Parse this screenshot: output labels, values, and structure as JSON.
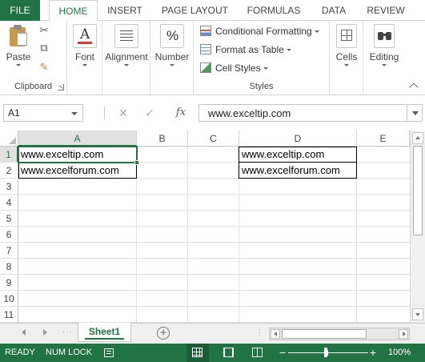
{
  "tabs": {
    "file": "FILE",
    "home": "HOME",
    "insert": "INSERT",
    "page_layout": "PAGE LAYOUT",
    "formulas": "FORMULAS",
    "data": "DATA",
    "review": "REVIEW"
  },
  "ribbon": {
    "clipboard": {
      "paste": "Paste",
      "group_label": "Clipboard"
    },
    "font": {
      "label": "Font"
    },
    "alignment": {
      "label": "Alignment"
    },
    "number": {
      "label": "Number"
    },
    "styles": {
      "conditional_formatting": "Conditional Formatting",
      "format_as_table": "Format as Table",
      "cell_styles": "Cell Styles",
      "group_label": "Styles"
    },
    "cells": {
      "label": "Cells"
    },
    "editing": {
      "label": "Editing"
    }
  },
  "formula_bar": {
    "name_box": "A1",
    "cancel_glyph": "✕",
    "enter_glyph": "✓",
    "fx_glyph": "fx",
    "content": "www.exceltip.com"
  },
  "grid": {
    "columns": [
      "A",
      "B",
      "C",
      "D",
      "E"
    ],
    "rows": [
      "1",
      "2",
      "3",
      "4",
      "5",
      "6",
      "7",
      "8",
      "9",
      "10",
      "11"
    ],
    "cells": {
      "A1": "www.exceltip.com",
      "A2": "www.excelforum.com",
      "D1": "www.exceltip.com",
      "D2": "www.excelforum.com"
    },
    "active_cell": "A1"
  },
  "sheets": {
    "active": "Sheet1",
    "add_glyph": "+",
    "nav_dots": "···",
    "splitter_dots": "⋮"
  },
  "status": {
    "ready": "READY",
    "num_lock": "NUM LOCK",
    "zoom_minus": "−",
    "zoom_plus": "+",
    "zoom": "100%"
  },
  "colors": {
    "accent": "#217346",
    "selected_header_bg": "#e1e1e1"
  },
  "icons": {
    "paste": "paste-icon",
    "cut": "scissors-icon",
    "copy": "copy-icon",
    "format_painter": "brush-icon",
    "font": "font-a-icon",
    "alignment": "align-lines-icon",
    "number": "percent-icon",
    "cells": "cells-icon",
    "editing": "binoculars-icon"
  }
}
